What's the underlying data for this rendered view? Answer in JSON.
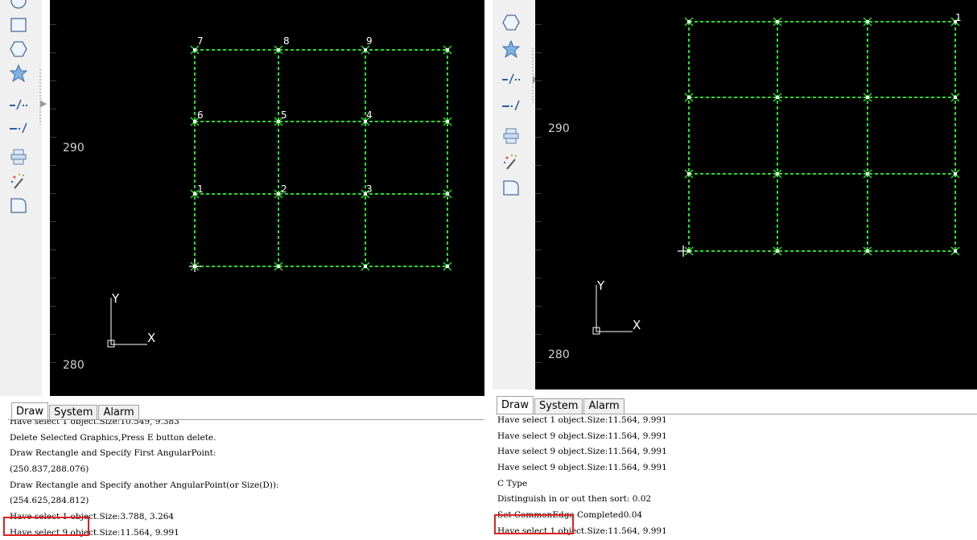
{
  "left": {
    "y_ticks": [
      "290",
      "280"
    ],
    "axis": {
      "x_label": "X",
      "y_label": "Y"
    },
    "point_labels": [
      "7",
      "8",
      "9",
      "6",
      "5",
      "4",
      "1",
      "2",
      "3"
    ],
    "tabs": [
      "Draw",
      "System",
      "Alarm"
    ],
    "log": [
      "Have select 1 object.Size:10.549, 9.383",
      "Delete Selected Graphics,Press E button delete.",
      "Draw Rectangle and Specify First AngularPoint:",
      "(250.837,288.076)",
      "Draw Rectangle and Specify another AngularPoint(or Size(D)):",
      "(254.625,284.812)",
      "Have select 1 object.Size:3.788, 3.264",
      "Have select 9 object.Size:11.564, 9.991"
    ]
  },
  "right": {
    "y_ticks": [
      "290",
      "280"
    ],
    "axis": {
      "x_label": "X",
      "y_label": "Y"
    },
    "point_labels": [
      "1"
    ],
    "tabs": [
      "Draw",
      "System",
      "Alarm"
    ],
    "log": [
      "Have select 1 object.Size:11.564, 9.991",
      "Have select 9 object.Size:11.564, 9.991",
      "Have select 9 object.Size:11.564, 9.991",
      "Have select 9 object.Size:11.564, 9.991",
      "C Type",
      "Distinguish in or out then  sort: 0.02",
      "Set CommonEdge Completed0.04",
      "Have select 1 object.Size:11.564, 9.991"
    ]
  },
  "colors": {
    "canvas": "#000000",
    "path": "#22dd22",
    "highlight": "#e02020"
  },
  "icons": [
    "ellipse-tool-icon",
    "rectangle-tool-icon",
    "hexagon-tool-icon",
    "star-tool-icon",
    "split-line-icon",
    "merge-line-icon",
    "array-copy-icon",
    "magic-wand-icon",
    "rounded-rect-icon"
  ]
}
